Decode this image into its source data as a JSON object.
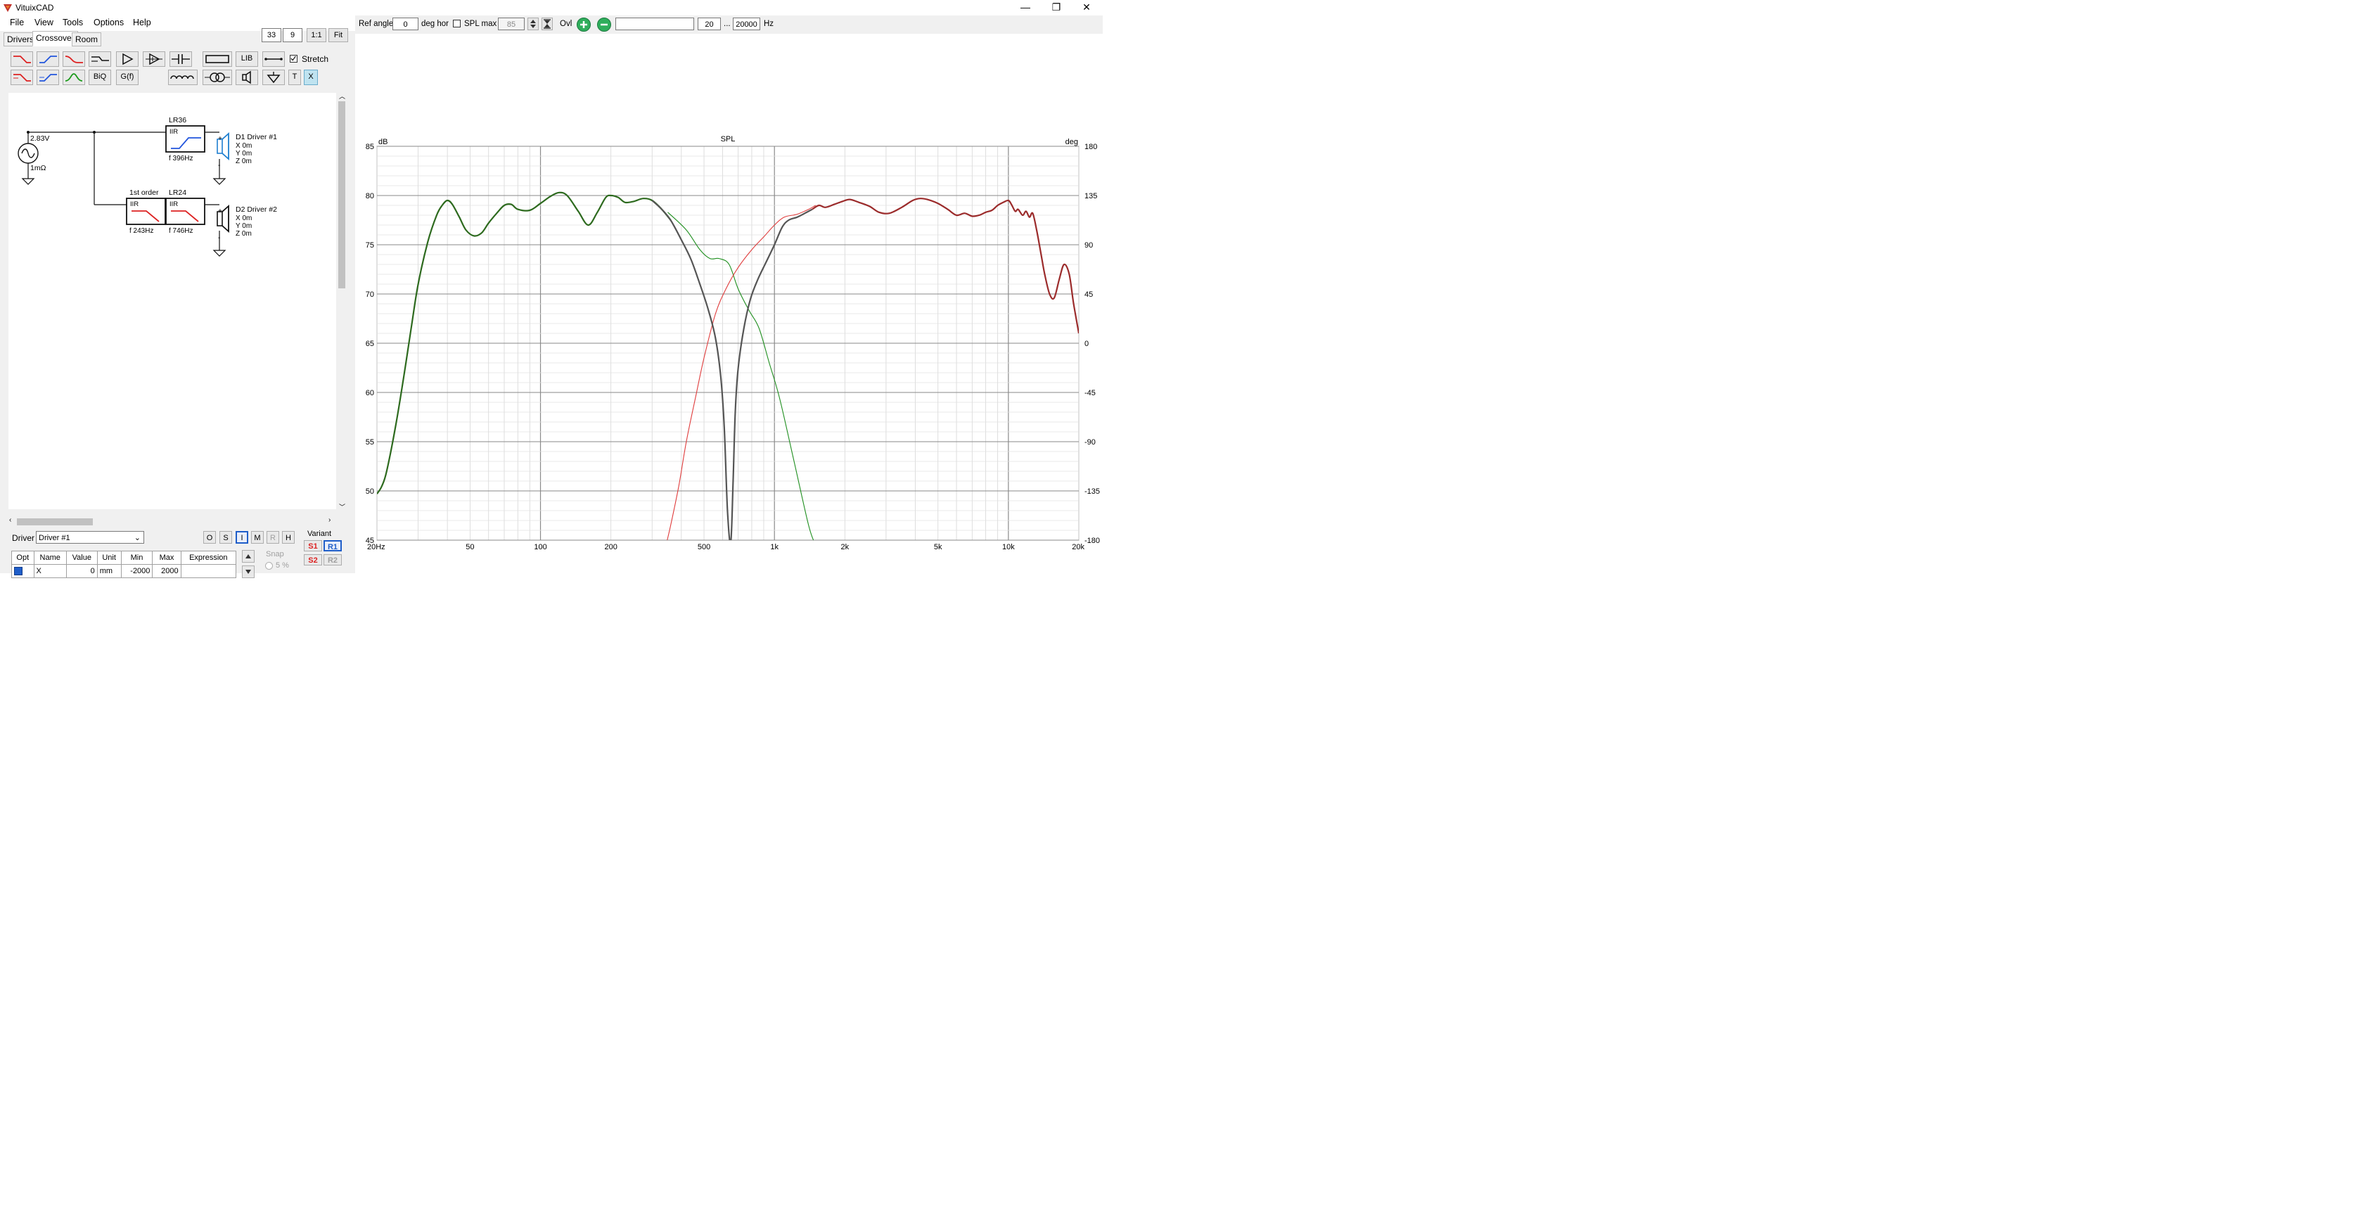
{
  "window": {
    "title": "VituixCAD",
    "btn_min": "—",
    "btn_restore": "❐",
    "btn_close": "✕"
  },
  "menu": [
    "File",
    "View",
    "Tools",
    "Options",
    "Help"
  ],
  "tabs": [
    {
      "label": "Drivers"
    },
    {
      "label": "Crossover",
      "active": true
    },
    {
      "label": "Room"
    }
  ],
  "zoom": {
    "x": "33",
    "y": "9",
    "btn_1to1": "1:1",
    "btn_fit": "Fit"
  },
  "toolbar": {
    "lib": "LIB",
    "biq": "BiQ",
    "gf": "G(f)",
    "t": "T",
    "x": "X",
    "stretch_label": "Stretch",
    "stretch_checked": true
  },
  "schematic": {
    "source_voltage": "2.83V",
    "source_impedance": "1mΩ",
    "block_lr36_title": "LR36",
    "block_lr36_type": "IIR",
    "block_lr36_freq": "f   396Hz",
    "block_1st_title": "1st order",
    "block_1st_type": "IIR",
    "block_1st_freq": "f   243Hz",
    "block_lr24_title": "LR24",
    "block_lr24_type": "IIR",
    "block_lr24_freq": "f   746Hz",
    "d1_name": "D1 Driver #1",
    "d1_x": "X 0m",
    "d1_y": "Y 0m",
    "d1_z": "Z 0m",
    "d2_name": "D2 Driver #2",
    "d2_x": "X 0m",
    "d2_y": "Y 0m",
    "d2_z": "Z 0m"
  },
  "bottom": {
    "driver_label": "Driver",
    "driver_value": "Driver #1",
    "mode_buttons": [
      "O",
      "S",
      "I",
      "M",
      "R",
      "H"
    ],
    "variant_label": "Variant",
    "snap_label": "Snap",
    "snap_value": "5 %",
    "table_headers": [
      "Opt",
      "Name",
      "Value",
      "Unit",
      "Min",
      "Max",
      "Expression"
    ],
    "table_row": [
      "",
      "X",
      "0",
      "mm",
      "-2000",
      "2000",
      ""
    ],
    "variants": [
      "S1",
      "R1",
      "S2",
      "R2"
    ]
  },
  "topbar": {
    "ref_angle_label": "Ref angle",
    "ref_angle_value": "0",
    "deg_hor_label": "deg hor",
    "spl_max_label": "SPL max",
    "spl_max_value": "85",
    "ovl_label": "Ovl",
    "freq_min": "20",
    "ellipsis": "...",
    "freq_max": "20000",
    "hz_label": "Hz",
    "text_field": ""
  },
  "chart_data": {
    "type": "line",
    "title": "SPL",
    "y_unit": "dB",
    "y2_unit": "deg",
    "x_scale": "log",
    "xlim": [
      20,
      20000
    ],
    "ylim": [
      45,
      85
    ],
    "y2lim": [
      -180,
      180
    ],
    "grid": true,
    "x_tick_labels": [
      "20Hz",
      "50",
      "100",
      "200",
      "500",
      "1k",
      "2k",
      "5k",
      "10k",
      "20k"
    ],
    "x_tick_values": [
      20,
      50,
      100,
      200,
      500,
      1000,
      2000,
      5000,
      10000,
      20000
    ],
    "y_ticks": [
      45,
      50,
      55,
      60,
      65,
      70,
      75,
      80,
      85
    ],
    "y2_ticks": [
      -180,
      -135,
      -90,
      -45,
      0,
      45,
      90,
      135,
      180
    ],
    "series": [
      {
        "color": "#1f8f1f",
        "width": 1.1,
        "x": [
          350,
          420,
          480,
          530,
          580,
          640,
          700,
          780,
          860,
          950,
          1050,
          1200,
          1400,
          1500
        ],
        "y": [
          78.3,
          76.5,
          74.5,
          73.6,
          73.6,
          73.0,
          70.5,
          68.3,
          66.5,
          63.0,
          59.5,
          53.5,
          46.5,
          44.5
        ]
      },
      {
        "color": "#e03c3c",
        "width": 1.1,
        "x": [
          340,
          360,
          390,
          420,
          460,
          500,
          560,
          620,
          700,
          800,
          900,
          1000,
          1100,
          1250,
          1400,
          1500
        ],
        "y": [
          44,
          46.5,
          50.5,
          55,
          59.5,
          63.5,
          68,
          70.5,
          72.7,
          74.5,
          75.8,
          77.0,
          77.8,
          78.1,
          78.6,
          79.0
        ]
      },
      {
        "color": "#2d6a1e",
        "width": 2.2,
        "x": [
          20,
          21,
          22,
          24,
          26,
          28,
          30,
          33,
          36,
          38,
          40,
          42,
          45,
          48,
          52,
          56,
          60,
          65,
          70,
          75,
          80,
          90,
          100,
          110,
          120,
          130,
          145,
          160,
          175,
          190,
          200,
          215,
          230,
          250,
          275,
          300,
          330,
          360
        ],
        "y": [
          49.7,
          50.5,
          52.0,
          56.5,
          61.5,
          66.5,
          71.0,
          75.3,
          78.0,
          79.0,
          79.5,
          79.1,
          77.8,
          76.5,
          75.9,
          76.2,
          77.2,
          78.2,
          79.0,
          79.1,
          78.6,
          78.5,
          79.2,
          79.9,
          80.3,
          80.0,
          78.4,
          77.0,
          78.3,
          79.8,
          80.0,
          79.8,
          79.3,
          79.4,
          79.7,
          79.5,
          78.6,
          77.5
        ]
      },
      {
        "color": "#555555",
        "width": 2.2,
        "x": [
          300,
          330,
          360,
          400,
          440,
          480,
          520,
          560,
          590,
          610,
          630,
          650,
          665,
          680,
          700,
          740,
          790,
          850,
          920,
          1000,
          1080,
          1150,
          1250,
          1350,
          1450
        ],
        "y": [
          79.5,
          78.6,
          77.5,
          75.5,
          73.5,
          71.0,
          68.5,
          65.5,
          61.5,
          56.5,
          48.0,
          44.7,
          50.5,
          58.0,
          62.5,
          66.5,
          69.5,
          71.5,
          73.2,
          75.0,
          76.8,
          77.5,
          77.8,
          78.2,
          78.6
        ]
      },
      {
        "color": "#9b2b2b",
        "width": 2.2,
        "x": [
          1450,
          1550,
          1650,
          1800,
          1950,
          2100,
          2300,
          2550,
          2800,
          3100,
          3500,
          3900,
          4200,
          4500,
          5000,
          5500,
          6000,
          6500,
          7000,
          7500,
          8000,
          8500,
          9000,
          9500,
          10000,
          10300,
          10700,
          11000,
          11500,
          11900,
          12300,
          12700,
          13200,
          13800,
          14300,
          15000,
          15700,
          16500,
          17300,
          18200,
          19000,
          20000
        ],
        "y": [
          78.6,
          79.0,
          78.8,
          79.1,
          79.4,
          79.6,
          79.3,
          78.9,
          78.3,
          78.2,
          78.8,
          79.5,
          79.7,
          79.6,
          79.2,
          78.6,
          78.0,
          78.2,
          77.9,
          78.0,
          78.3,
          78.5,
          79.0,
          79.3,
          79.5,
          79.1,
          78.4,
          78.6,
          78.0,
          78.4,
          77.8,
          78.2,
          76.5,
          74.0,
          72.0,
          70.0,
          69.6,
          71.5,
          73.0,
          72.0,
          69.0,
          66.0
        ]
      }
    ]
  }
}
